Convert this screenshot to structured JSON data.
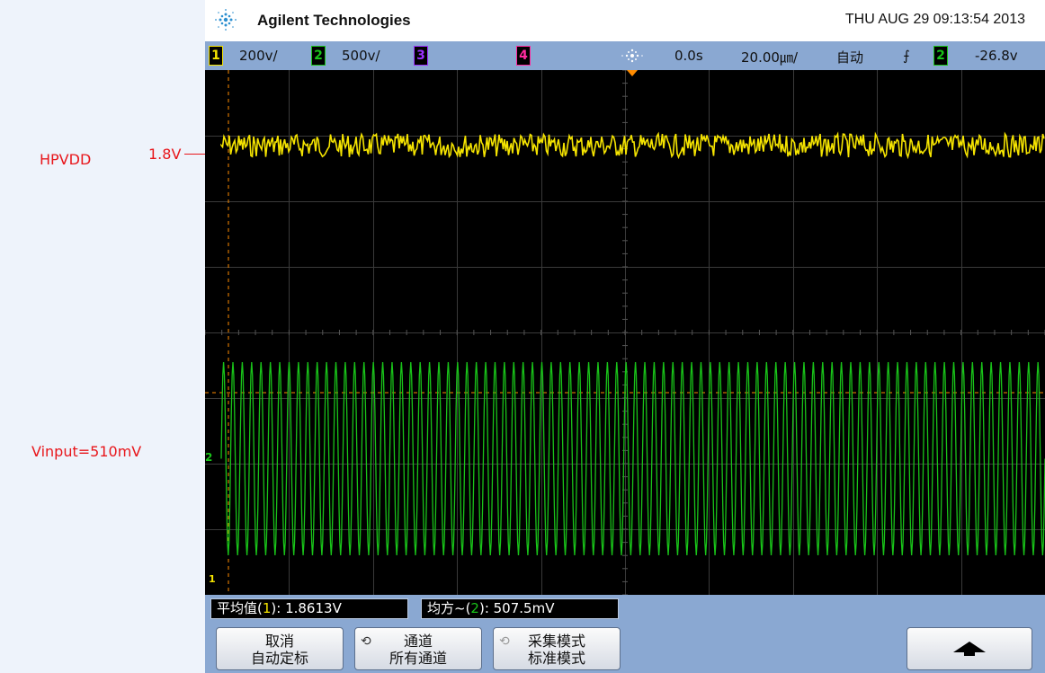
{
  "annotations": {
    "hpvdd": "HPVDD",
    "level_18": "1.8V",
    "vinput": "Vinput=510mV"
  },
  "header": {
    "brand": "Agilent Technologies",
    "datetime": "THU AUG 29 09:13:54 2013"
  },
  "status": {
    "ch1_num": "1",
    "ch1_scale": "200ⅴ/",
    "ch2_num": "2",
    "ch2_scale": "500ⅴ/",
    "ch3_num": "3",
    "ch4_num": "4",
    "time_offset": "0.0s",
    "time_scale": "20.00㎛/",
    "trigger_mode": "自动",
    "trigger_slope": "⨍",
    "trigger_source": "2",
    "trigger_level": "-26.8ⅴ"
  },
  "measurements": {
    "avg_label": "平均值(",
    "avg_ch": "1",
    "avg_value": "): 1.8613V",
    "rms_label": "均方~(",
    "rms_ch": "2",
    "rms_value": "): 507.5mV"
  },
  "softkeys": {
    "cancel_line1": "取消",
    "cancel_line2": "自动定标",
    "channel_line1": "通道",
    "channel_line2": "所有通道",
    "acq_line1": "采集模式",
    "acq_line2": "标准模式"
  },
  "markers": {
    "ch1_ground": "1",
    "ch2_ground": "2"
  },
  "colors": {
    "ch1": "#f5e400",
    "ch2": "#19c319",
    "ch3": "#9b30ff",
    "ch4": "#ff2aa0",
    "annotation": "#e8161b",
    "trigger": "#ff8c00"
  },
  "chart_data": {
    "type": "line",
    "series": [
      {
        "name": "1",
        "shape": "noisy DC",
        "level": 1.8613,
        "unit": "V"
      },
      {
        "name": "2",
        "shape": "sine",
        "rms": 0.5075,
        "unit": "V",
        "cycles_on_screen": 88
      }
    ]
  }
}
